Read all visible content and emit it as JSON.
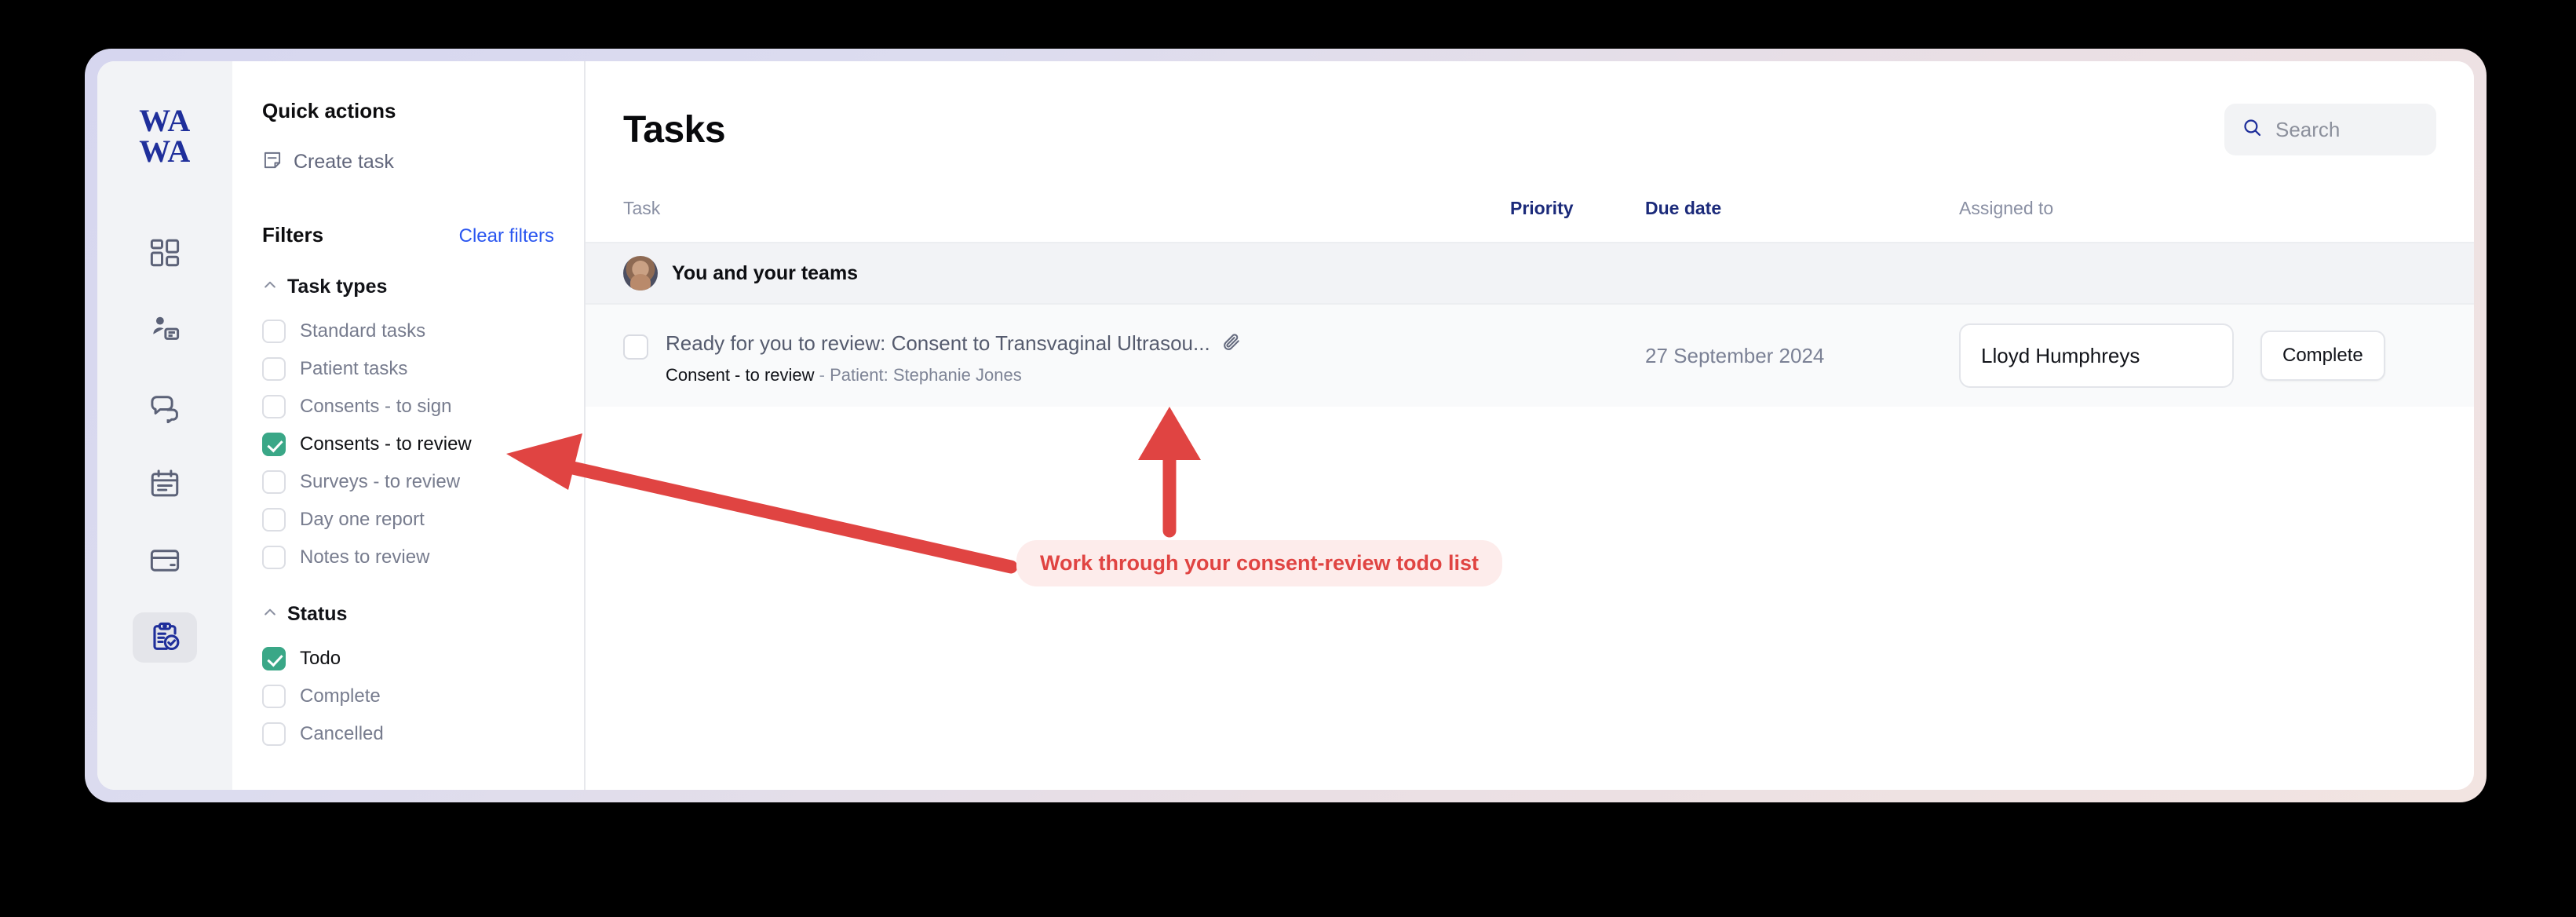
{
  "brand": {
    "logo_text_line1": "WA",
    "logo_text_line2": "WA",
    "accent_navy": "#1f2f9b"
  },
  "rail": {
    "items": [
      {
        "icon": "dashboard-grid-icon",
        "active": false
      },
      {
        "icon": "patient-record-icon",
        "active": false
      },
      {
        "icon": "messages-chat-icon",
        "active": false
      },
      {
        "icon": "calendar-icon",
        "active": false
      },
      {
        "icon": "billing-card-icon",
        "active": false
      },
      {
        "icon": "tasks-clipboard-check-icon",
        "active": true
      }
    ]
  },
  "filters_panel": {
    "quick_actions_title": "Quick actions",
    "create_task_label": "Create task",
    "create_task_icon": "note-add-icon",
    "filters_label": "Filters",
    "clear_filters_label": "Clear filters",
    "groups": [
      {
        "title": "Task types",
        "chevron": "chevron-up-icon",
        "options": [
          {
            "label": "Standard tasks",
            "checked": false
          },
          {
            "label": "Patient tasks",
            "checked": false
          },
          {
            "label": "Consents - to sign",
            "checked": false
          },
          {
            "label": "Consents - to review",
            "checked": true
          },
          {
            "label": "Surveys - to review",
            "checked": false
          },
          {
            "label": "Day one report",
            "checked": false
          },
          {
            "label": "Notes to review",
            "checked": false
          }
        ]
      },
      {
        "title": "Status",
        "chevron": "chevron-up-icon",
        "options": [
          {
            "label": "Todo",
            "checked": true
          },
          {
            "label": "Complete",
            "checked": false
          },
          {
            "label": "Cancelled",
            "checked": false
          }
        ]
      }
    ],
    "checked_color": "#3aa787",
    "link_color": "#2a56f0"
  },
  "main": {
    "page_title": "Tasks",
    "search": {
      "icon": "search-icon",
      "placeholder": "Search",
      "value": ""
    },
    "columns": {
      "task": "Task",
      "priority": "Priority",
      "due_date": "Due date",
      "assigned_to": "Assigned to"
    },
    "group": {
      "label": "You and your teams",
      "avatar": "user-avatar"
    },
    "rows": [
      {
        "checked": false,
        "title": "Ready for you to review: Consent to Transvaginal Ultrasou...",
        "attachment_icon": "paperclip-icon",
        "subtype": "Consent - to review",
        "separator": "-",
        "patient": "Patient: Stephanie Jones",
        "priority": "",
        "due_date": "27 September 2024",
        "assignee": "Lloyd Humphreys",
        "action_label": "Complete"
      }
    ]
  },
  "annotation": {
    "callout_text": "Work through your consent-review todo list",
    "callout_bg": "#fdeceb",
    "callout_color": "#e04442",
    "arrow_color": "#e04442"
  }
}
